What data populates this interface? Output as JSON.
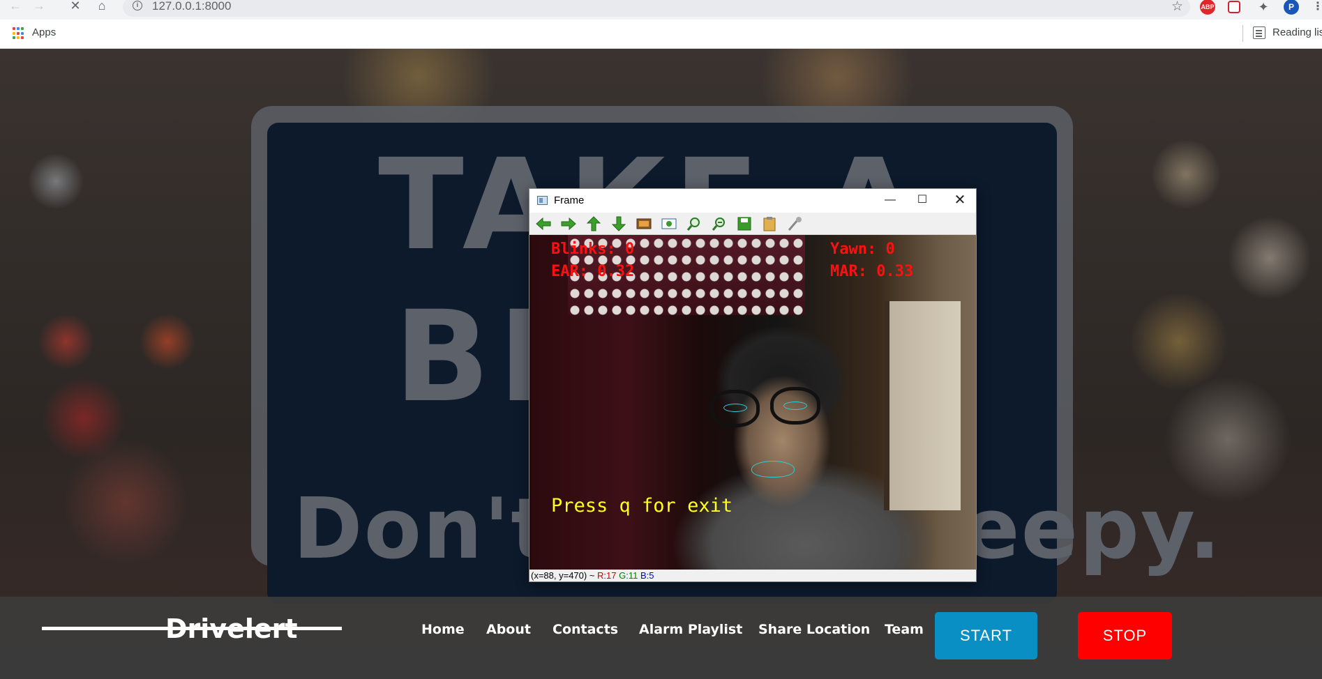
{
  "browser": {
    "url": "127.0.0.1:8000",
    "bookmarks_apps_label": "Apps",
    "reading_list_label": "Reading list",
    "extensions": [
      {
        "name": "adblock-plus",
        "label": "ABP",
        "color": "#e0262a"
      },
      {
        "name": "pocket",
        "label": "",
        "color": "#d3202e"
      },
      {
        "name": "profile",
        "label": "P",
        "color": "#1a56b8"
      }
    ]
  },
  "background_sign": {
    "line1": "TAKE A",
    "line2": "BREAK",
    "line3": "Don't Drive Sleepy."
  },
  "navbar": {
    "brand": "Drivelert",
    "links": [
      "Home",
      "About",
      "Contacts",
      "Alarm Playlist",
      "Share Location",
      "Team"
    ],
    "start_label": "START",
    "stop_label": "STOP",
    "start_color": "#0a8fc4",
    "stop_color": "#ff0000"
  },
  "frame_window": {
    "title": "Frame",
    "toolbar_icons": [
      "pan-left-icon",
      "pan-right-icon",
      "pan-up-icon",
      "pan-down-icon",
      "zoom-fit-icon",
      "zoom-original-icon",
      "zoom-in-icon",
      "zoom-out-icon",
      "save-icon",
      "copy-icon",
      "properties-icon"
    ],
    "overlay": {
      "blinks": "Blinks: 0",
      "ear": "EAR: 0.32",
      "yawn": "Yawn: 0",
      "mar": "MAR: 0.33",
      "exit_hint": "Press q for exit"
    },
    "status": {
      "coords": "(x=88, y=470) ~",
      "r": "R:17",
      "g": "G:11",
      "b": "B:5"
    }
  }
}
